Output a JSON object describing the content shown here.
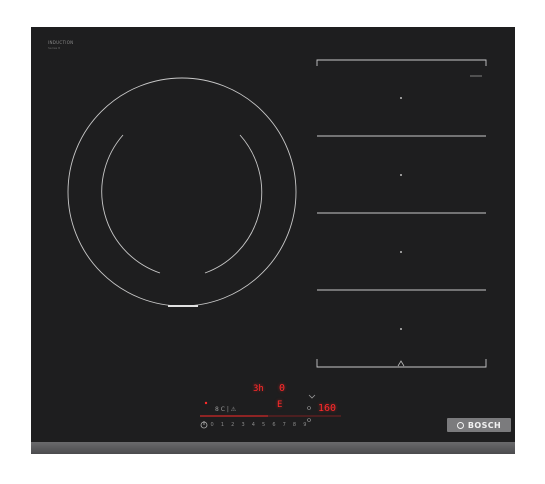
{
  "brand": {
    "series_label": "INDUCTION",
    "series_sub": "Series 8",
    "logo_text": "BOSCH"
  },
  "display": {
    "timer_hours": "3h",
    "timer_minutes": "0",
    "zone_level": "E",
    "temperature": "160",
    "status": "8 C | ⚠"
  },
  "power_scale": [
    "0",
    "1",
    "2",
    "3",
    "4",
    "5",
    "6",
    "7",
    "8",
    "9"
  ],
  "colors": {
    "glass": "#1e1e1f",
    "led_red": "#ff2a2a",
    "ring_gray": "#c8c8c8",
    "badge": "#7b7b7d"
  },
  "icons": [
    "power-icon",
    "lock-icon",
    "timer-icon",
    "flex-zone-icon",
    "bosch-logo-icon"
  ]
}
